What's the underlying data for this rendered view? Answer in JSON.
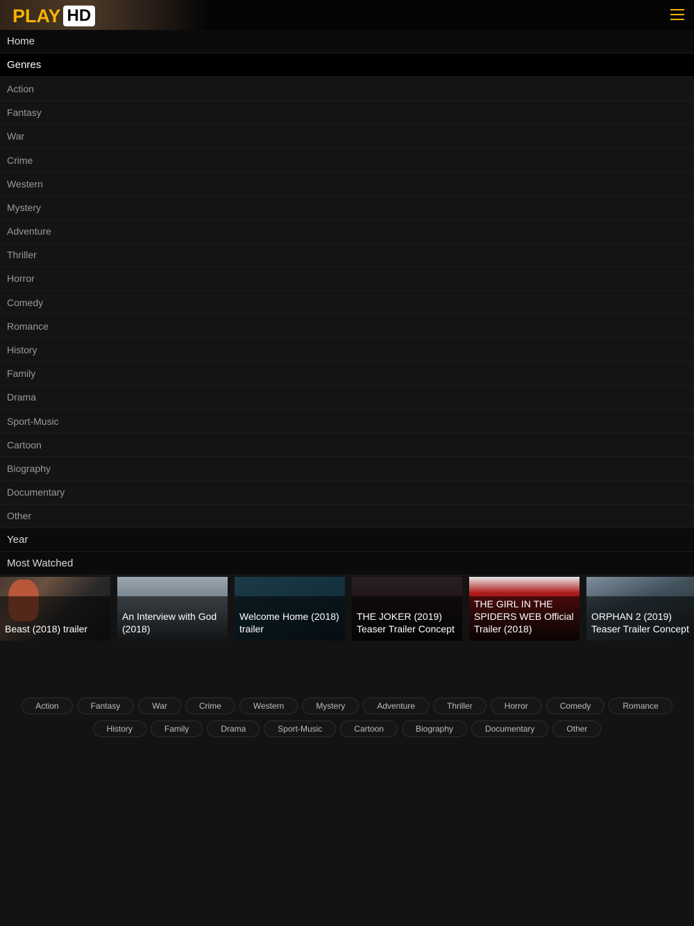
{
  "header": {
    "logo_play": "PLAY",
    "logo_hd": "HD"
  },
  "menu": {
    "home": "Home",
    "genres": "Genres",
    "genre_items": [
      "Action",
      "Fantasy",
      "War",
      "Crime",
      "Western",
      "Mystery",
      "Adventure",
      "Thriller",
      "Horror",
      "Comedy",
      "Romance",
      "History",
      "Family",
      "Drama",
      "Sport-Music",
      "Cartoon",
      "Biography",
      "Documentary",
      "Other"
    ],
    "year": "Year",
    "most_watched": "Most Watched"
  },
  "most_watched": [
    {
      "title": "Beast (2018) trailer"
    },
    {
      "title": "An Interview with God (2018)"
    },
    {
      "title": "Welcome Home (2018) trailer"
    },
    {
      "title": "THE JOKER (2019) Teaser Trailer Concept"
    },
    {
      "title": "THE GIRL IN THE SPIDERS WEB Official Trailer (2018)"
    },
    {
      "title": "ORPHAN 2 (2019) Teaser Trailer Concept"
    }
  ],
  "tags": {
    "row1": [
      "Action",
      "Fantasy",
      "War",
      "Crime",
      "Western",
      "Mystery",
      "Adventure",
      "Thriller",
      "Horror",
      "Comedy",
      "Romance"
    ],
    "row2": [
      "History",
      "Family",
      "Drama",
      "Sport-Music",
      "Cartoon",
      "Biography",
      "Documentary",
      "Other"
    ]
  },
  "colors": {
    "accent": "#f5b400",
    "background": "#131313"
  }
}
